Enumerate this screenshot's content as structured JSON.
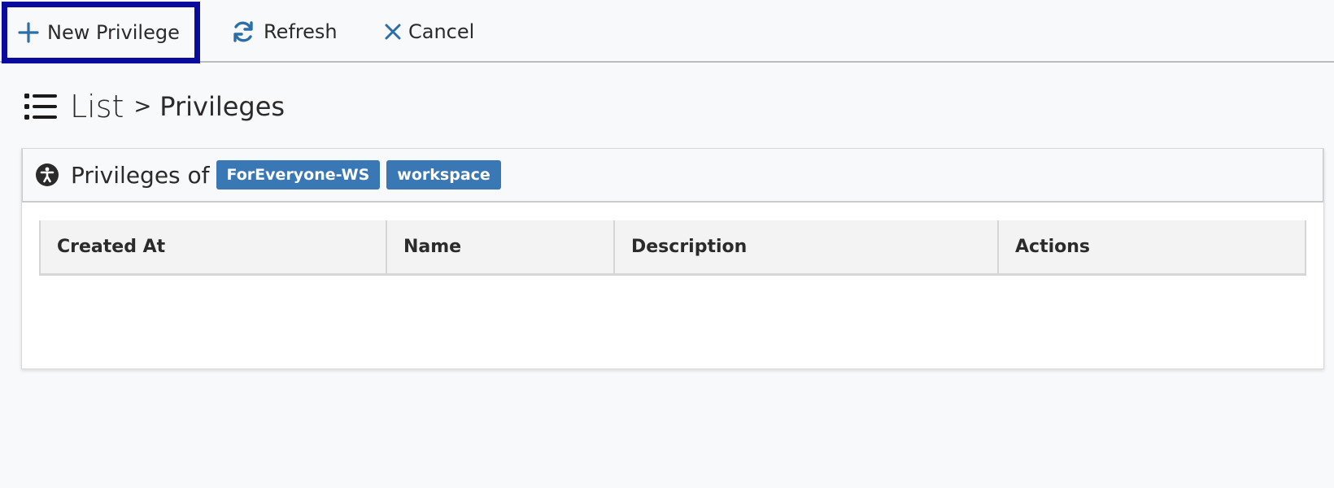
{
  "toolbar": {
    "new_label": "New Privilege",
    "refresh_label": "Refresh",
    "cancel_label": "Cancel"
  },
  "breadcrumb": {
    "root": "List",
    "separator": ">",
    "current": "Privileges"
  },
  "panel": {
    "title": "Privileges of",
    "tags": [
      "ForEveryone-WS",
      "workspace"
    ]
  },
  "table": {
    "columns": [
      "Created At",
      "Name",
      "Description",
      "Actions"
    ],
    "rows": []
  },
  "colors": {
    "accent": "#3a77b5",
    "focus_border": "#0a0a9e",
    "background": "#f8f9fb"
  },
  "icons": {
    "new": "plus-icon",
    "refresh": "refresh-icon",
    "cancel": "close-icon",
    "breadcrumb": "list-icon",
    "panel": "accessibility-icon"
  }
}
